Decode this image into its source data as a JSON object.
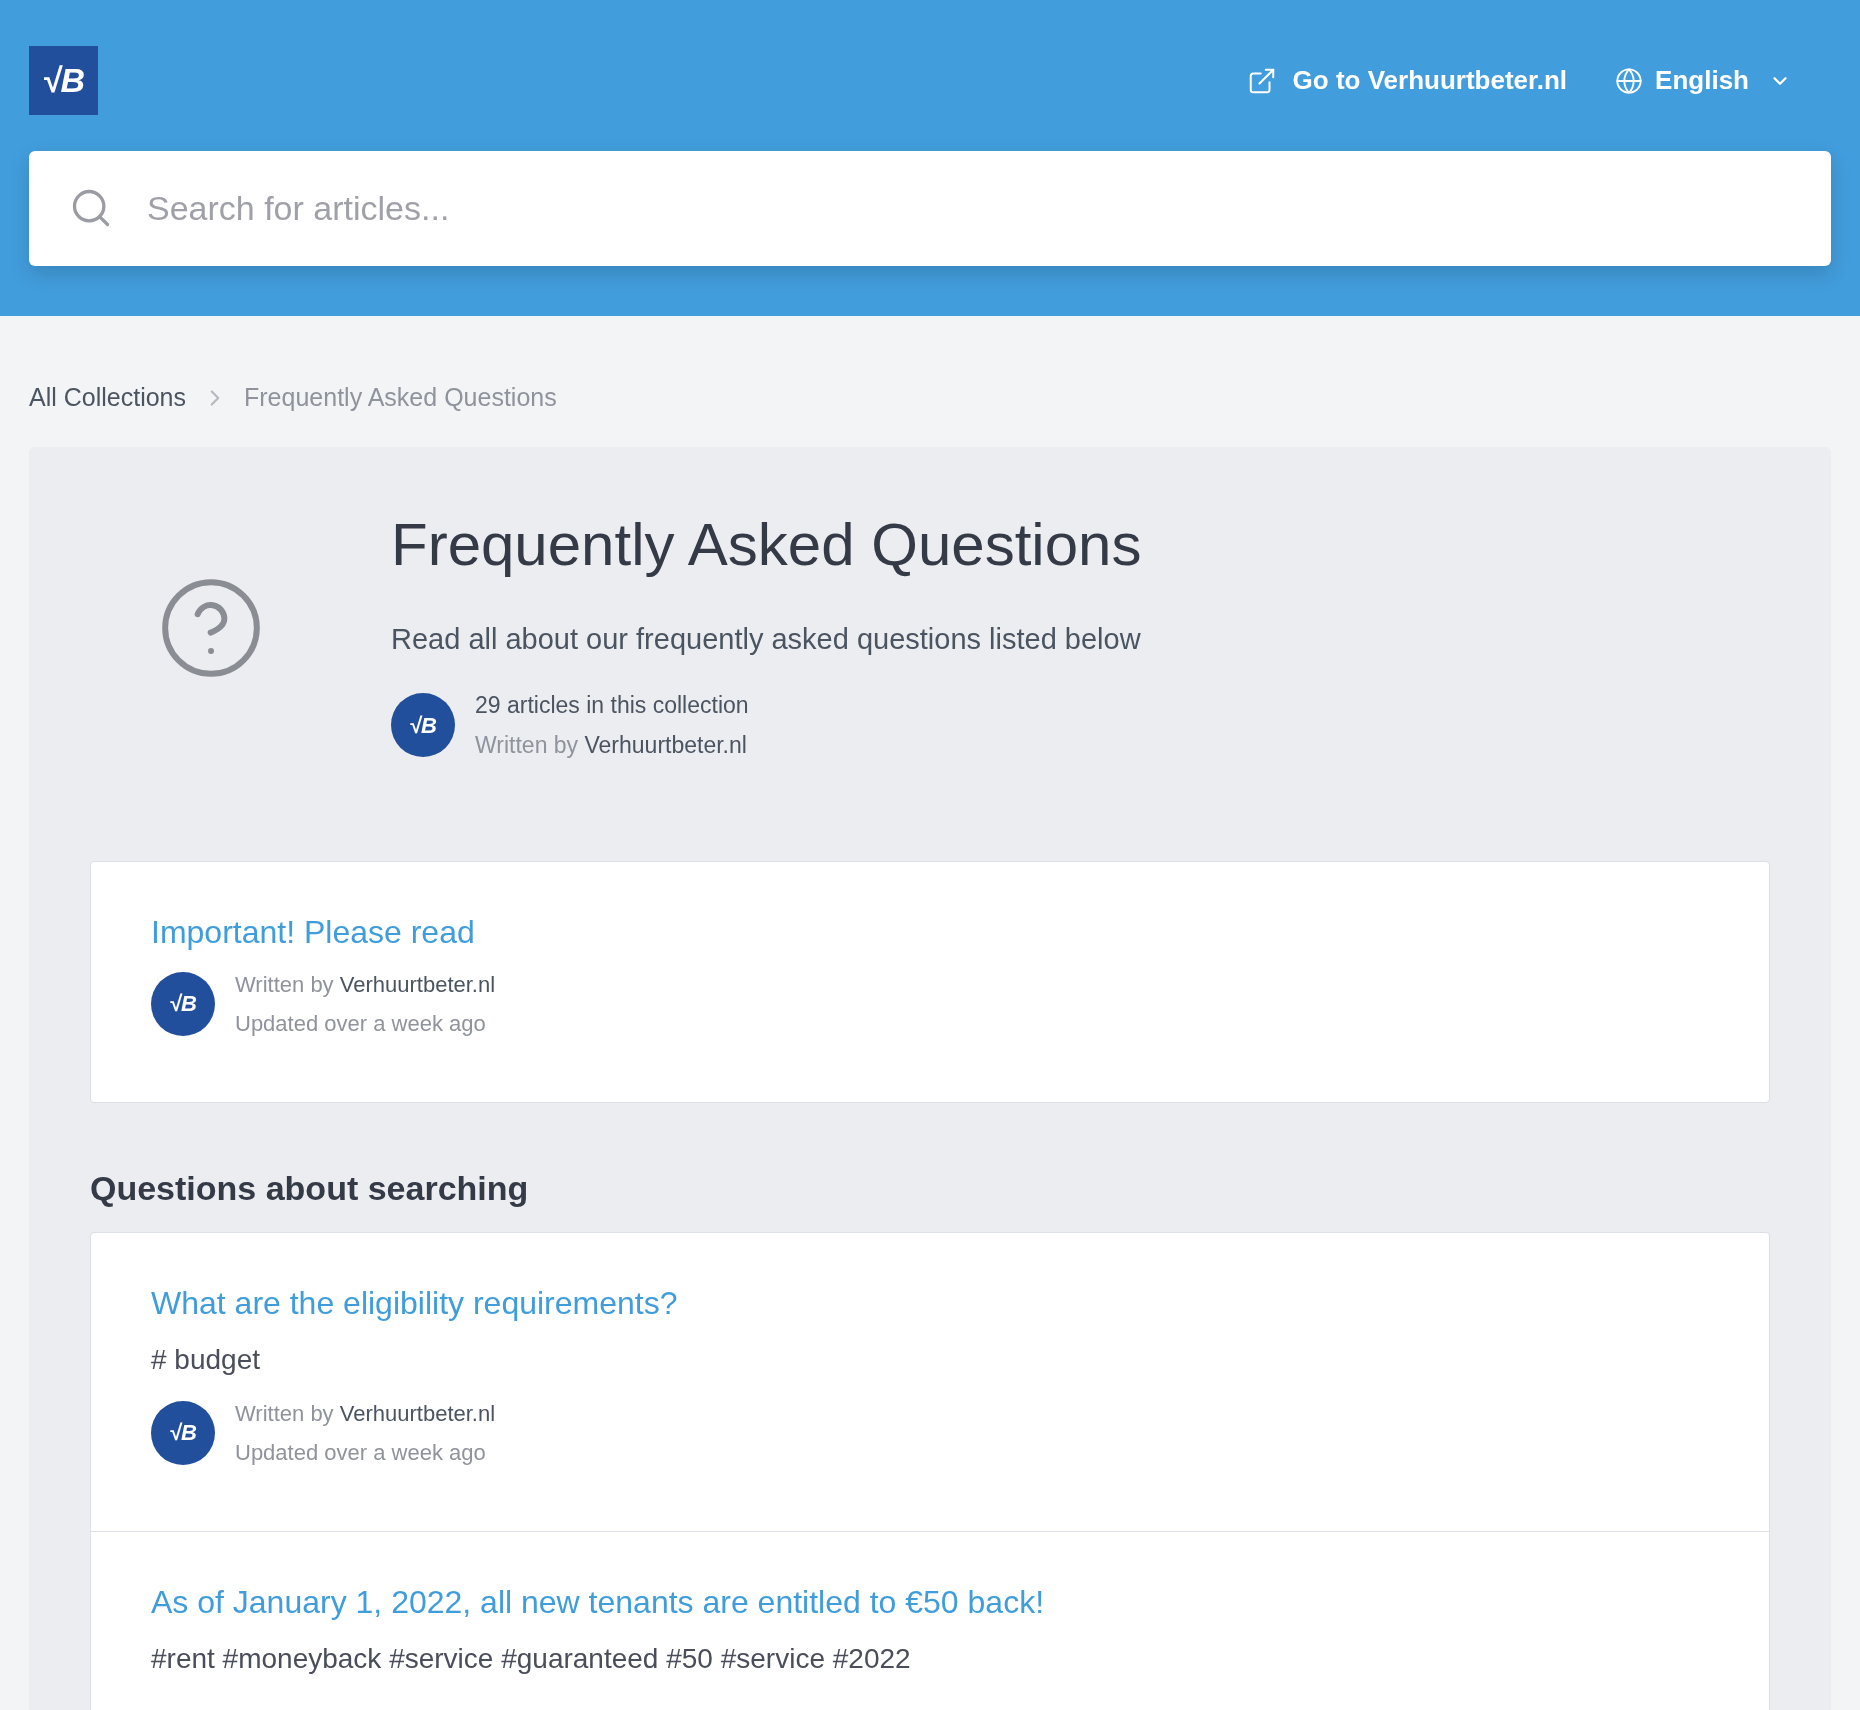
{
  "header": {
    "logo_text": "√B",
    "links": [
      {
        "kind": "external",
        "label": "Go to Verhuurtbeter.nl"
      },
      {
        "kind": "language",
        "label": "English"
      }
    ],
    "search": {
      "placeholder": "Search for articles..."
    }
  },
  "breadcrumb": [
    "All Collections",
    "Frequently Asked Questions"
  ],
  "collection": {
    "title": "Frequently Asked Questions",
    "description": "Read all about our frequently asked questions listed below",
    "avatar_text": "√B",
    "count": "29 articles in this collection",
    "written_by": "Written by",
    "author": "Verhuurtbeter.nl"
  },
  "sections": [
    {
      "articles": [
        {
          "title": "Important! Please read",
          "avatar_text": "√B",
          "written_by": "Written by",
          "author": "Verhuurtbeter.nl",
          "updated": "Updated over a week ago"
        }
      ]
    },
    {
      "heading": "Questions about searching",
      "articles": [
        {
          "title": "What are the eligibility requirements?",
          "tags": "# budget",
          "avatar_text": "√B",
          "written_by": "Written by",
          "author": "Verhuurtbeter.nl",
          "updated": "Updated over a week ago"
        },
        {
          "title": "As of January 1, 2022, all new tenants are entitled to €50 back!",
          "tags": "#rent #moneyback #service #guaranteed #50 #service #2022"
        }
      ]
    }
  ]
}
